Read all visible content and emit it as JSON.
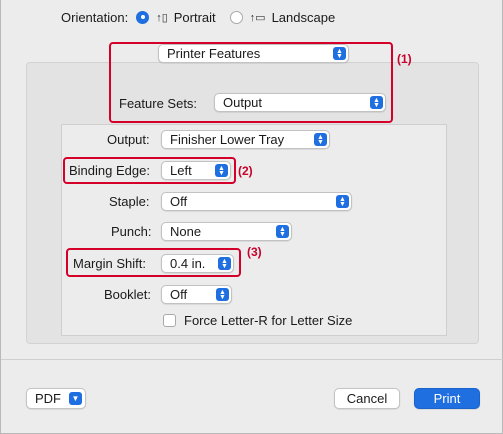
{
  "orientation": {
    "label": "Orientation:",
    "portrait": "Portrait",
    "landscape": "Landscape",
    "selected": "Portrait"
  },
  "section_popup": {
    "value": "Printer Features"
  },
  "feature_sets": {
    "label": "Feature Sets:",
    "value": "Output"
  },
  "fields": {
    "output": {
      "label": "Output:",
      "value": "Finisher Lower Tray"
    },
    "binding_edge": {
      "label": "Binding Edge:",
      "value": "Left"
    },
    "staple": {
      "label": "Staple:",
      "value": "Off"
    },
    "punch": {
      "label": "Punch:",
      "value": "None"
    },
    "margin_shift": {
      "label": "Margin Shift:",
      "value": "0.4 in."
    },
    "booklet": {
      "label": "Booklet:",
      "value": "Off"
    },
    "force_letter_r": {
      "label": "Force Letter-R for Letter Size",
      "checked": false
    }
  },
  "annotations": {
    "a1": "(1)",
    "a2": "(2)",
    "a3": "(3)",
    "color": "#d4002a"
  },
  "footer": {
    "pdf": "PDF",
    "cancel": "Cancel",
    "print": "Print"
  },
  "colors": {
    "accent": "#1f6fe0"
  }
}
